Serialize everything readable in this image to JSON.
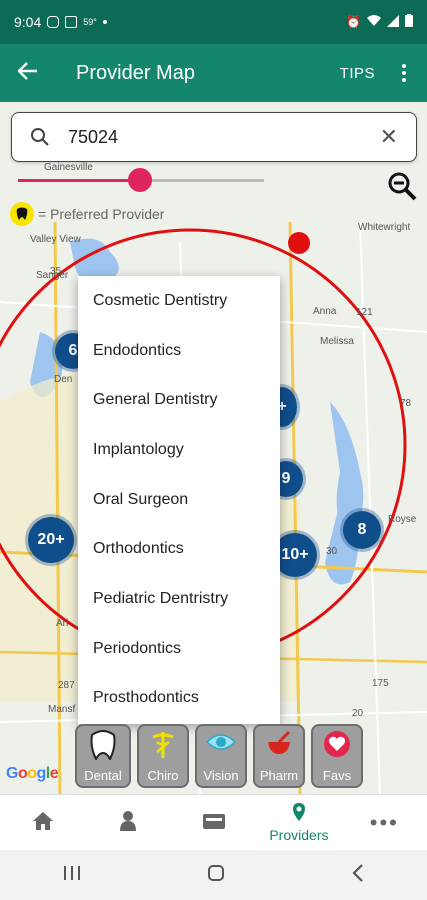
{
  "status_bar": {
    "time": "9:04",
    "temp": "59°"
  },
  "app_bar": {
    "title": "Provider Map",
    "tips_label": "TIPS"
  },
  "search": {
    "value": "75024"
  },
  "map_labels": {
    "gainesville": "Gainesville",
    "valley_view": "Valley View",
    "whitewright": "Whitewright",
    "sanger": "Sanger",
    "anna": "Anna",
    "melissa": "Melissa",
    "royse": "Royse",
    "den": "Den",
    "arl": "Arl",
    "mans": "Mansf",
    "hw_35": "35",
    "hw_121": "121",
    "hw_78": "78",
    "hw_287": "287",
    "hw_175": "175",
    "hw_30": "30",
    "hw_20": "20"
  },
  "preferred_provider_label": "= Preferred Provider",
  "clusters": [
    {
      "label": "6"
    },
    {
      "label": "20+"
    },
    {
      "label": "+"
    },
    {
      "label": "9"
    },
    {
      "label": "10+"
    },
    {
      "label": "8"
    }
  ],
  "dropdown_items": [
    "Cosmetic Dentistry",
    "Endodontics",
    "General Dentistry",
    "Implantology",
    "Oral Surgeon",
    "Orthodontics",
    "Pediatric Dentristry",
    "Periodontics",
    "Prosthodontics"
  ],
  "categories": [
    {
      "label": "Dental",
      "icon": "tooth-icon"
    },
    {
      "label": "Chiro",
      "icon": "caduceus-icon"
    },
    {
      "label": "Vision",
      "icon": "eye-icon"
    },
    {
      "label": "Pharm",
      "icon": "mortar-icon"
    },
    {
      "label": "Favs",
      "icon": "heart-icon"
    }
  ],
  "bottom_nav": {
    "providers_label": "Providers",
    "active_item": "Providers",
    "active_color": "#13866b"
  },
  "google_label": "Google",
  "colors": {
    "primary": "#13866b",
    "status": "#0b6b55",
    "accent": "#e0245e",
    "cluster": "#104e8b",
    "radius_circle": "#e01010"
  }
}
